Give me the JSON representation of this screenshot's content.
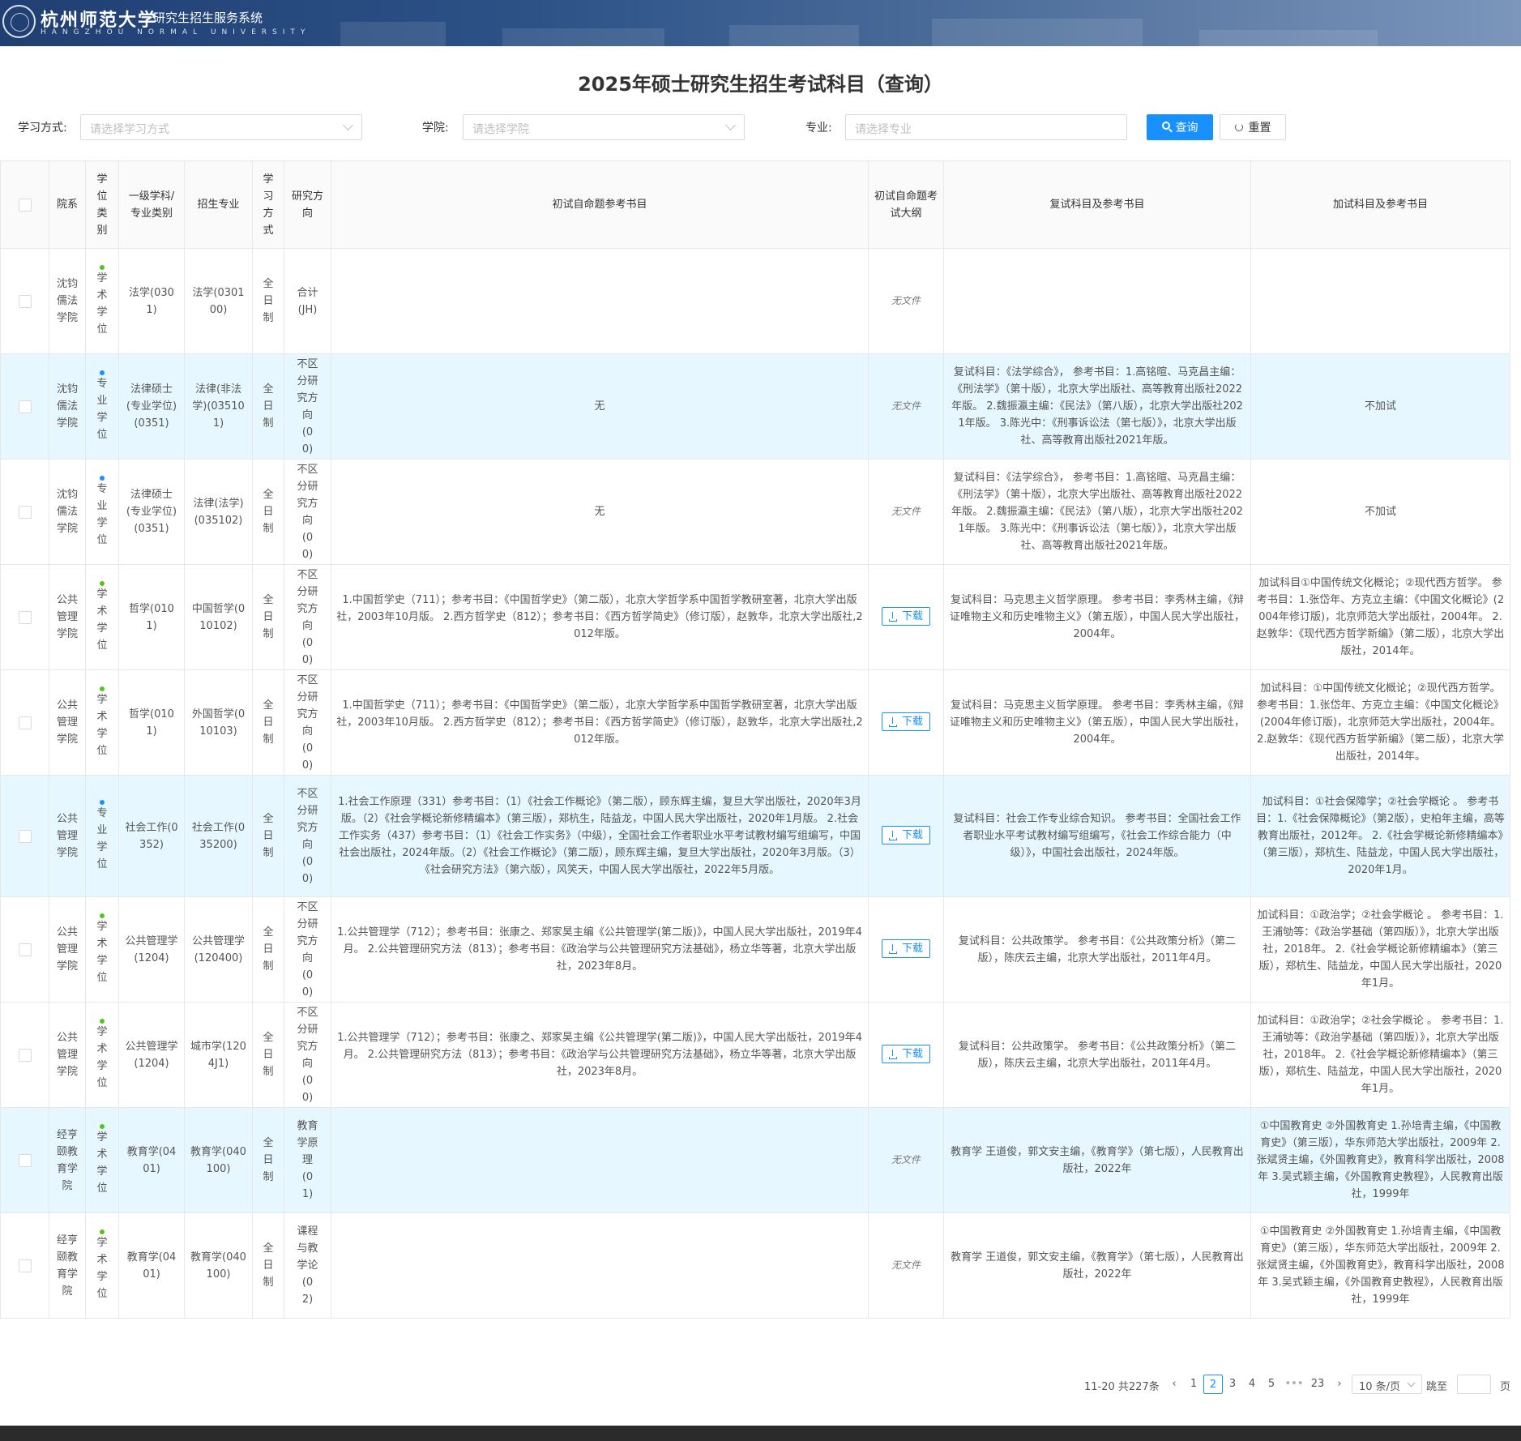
{
  "header": {
    "logo_text": "杭州师范大学",
    "logo_en": "HANGZHOU NORMAL UNIVERSITY",
    "system_title": "研究生招生服务系统"
  },
  "page_title": "2025年硕士研究生招生考试科目（查询）",
  "filters": {
    "mode_label": "学习方式:",
    "mode_placeholder": "请选择学习方式",
    "college_label": "学院:",
    "college_placeholder": "请选择学院",
    "major_label": "专业:",
    "major_placeholder": "请选择专业",
    "search_label": "查询",
    "reset_label": "重置"
  },
  "table": {
    "columns": [
      "院系",
      "学位类别",
      "一级学科/专业类别",
      "招生专业",
      "学习方式",
      "研究方向",
      "初试自命题参考书目",
      "初试自命题考试大纲",
      "复试科目及参考书目",
      "加试科目及参考书目"
    ],
    "rows": [
      {
        "college": "沈钧儒法学院",
        "degree_type": "学术学位",
        "dot": "green",
        "discipline": "法学(0301)",
        "major": "法学(030100)",
        "mode": "全日制",
        "direction": "合计(JH)",
        "initial_books": "",
        "outline": "无文件",
        "retest": "",
        "extra": ""
      },
      {
        "college": "沈钧儒法学院",
        "degree_type": "专业学位",
        "dot": "blue",
        "discipline": "法律硕士(专业学位)(0351)",
        "major": "法律(非法学)(035101)",
        "mode": "全日制",
        "direction": "不区分研究方向(00)",
        "initial_books": "无",
        "outline": "无文件",
        "retest": "复试科目：《法学综合》， 参考书目：1.高铭暄、马克昌主编：《刑法学》（第十版），北京大学出版社、高等教育出版社2022年版。 2.魏振瀛主编：《民法》（第八版），北京大学出版社2021年版。 3.陈光中：《刑事诉讼法（第七版）》，北京大学出版社、高等教育出版社2021年版。",
        "extra": "不加试"
      },
      {
        "college": "沈钧儒法学院",
        "degree_type": "专业学位",
        "dot": "blue",
        "discipline": "法律硕士(专业学位)(0351)",
        "major": "法律(法学)(035102)",
        "mode": "全日制",
        "direction": "不区分研究方向(00)",
        "initial_books": "无",
        "outline": "无文件",
        "retest": "复试科目：《法学综合》， 参考书目：1.高铭暄、马克昌主编：《刑法学》（第十版），北京大学出版社、高等教育出版社2022年版。 2.魏振瀛主编：《民法》（第八版），北京大学出版社2021年版。 3.陈光中：《刑事诉讼法（第七版）》，北京大学出版社、高等教育出版社2021年版。",
        "extra": "不加试"
      },
      {
        "college": "公共管理学院",
        "degree_type": "学术学位",
        "dot": "green",
        "discipline": "哲学(0101)",
        "major": "中国哲学(010102)",
        "mode": "全日制",
        "direction": "不区分研究方向(00)",
        "initial_books": "1.中国哲学史（711）；参考书目：《中国哲学史》（第二版），北京大学哲学系中国哲学教研室著，北京大学出版社，2003年10月版。 2.西方哲学史（812）；参考书目：《西方哲学简史》（修订版），赵敦华，北京大学出版社,2012年版。",
        "outline": "下载",
        "retest": "复试科目：马克思主义哲学原理。 参考书目：李秀林主编，《辩证唯物主义和历史唯物主义》（第五版），中国人民大学出版社，2004年。",
        "extra": "加试科目①中国传统文化概论；②现代西方哲学。 参考书目：1.张岱年、方克立主编：《中国文化概论》(2004年修订版)，北京师范大学出版社，2004年。 2.赵敦华：《现代西方哲学新编》（第二版），北京大学出版社，2014年。"
      },
      {
        "college": "公共管理学院",
        "degree_type": "学术学位",
        "dot": "green",
        "discipline": "哲学(0101)",
        "major": "外国哲学(010103)",
        "mode": "全日制",
        "direction": "不区分研究方向(00)",
        "initial_books": "1.中国哲学史（711）；参考书目：《中国哲学史》（第二版），北京大学哲学系中国哲学教研室著，北京大学出版社，2003年10月版。 2.西方哲学史（812）；参考书目：《西方哲学简史》（修订版），赵敦华，北京大学出版社,2012年版。",
        "outline": "下载",
        "retest": "复试科目：马克思主义哲学原理。 参考书目：李秀林主编，《辩证唯物主义和历史唯物主义》（第五版），中国人民大学出版社，2004年。",
        "extra": "加试科目：①中国传统文化概论；②现代西方哲学。 参考书目：1.张岱年、方克立主编：《中国文化概论》(2004年修订版)，北京师范大学出版社，2004年。 2.赵敦华：《现代西方哲学新编》（第二版），北京大学出版社，2014年。"
      },
      {
        "college": "公共管理学院",
        "degree_type": "专业学位",
        "dot": "blue",
        "discipline": "社会工作(0352)",
        "major": "社会工作(035200)",
        "mode": "全日制",
        "direction": "不区分研究方向(00)",
        "initial_books": "1.社会工作原理（331）参考书目：（1）《社会工作概论》（第二版），顾东辉主编，复旦大学出版社，2020年3月版。（2）《社会学概论新修精编本》（第三版），郑杭生，陆益龙，中国人民大学出版社，2020年1月版。 2.社会工作实务（437）参考书目：（1）《社会工作实务》（中级），全国社会工作者职业水平考试教材编写组编写，中国社会出版社，2024年版。（2）《社会工作概论》（第二版），顾东辉主编，复旦大学出版社，2020年3月版。（3）《社会研究方法》（第六版），风笑天，中国人民大学出版社，2022年5月版。",
        "outline": "下载",
        "retest": "复试科目：社会工作专业综合知识。 参考书目：全国社会工作者职业水平考试教材编写组编写，《社会工作综合能力（中级）》，中国社会出版社，2024年版。",
        "extra": "加试科目：①社会保障学；②社会学概论 。 参考书目：1.《社会保障概论》（第2版），史柏年主编，高等教育出版社，2012年。 2.《社会学概论新修精编本》（第三版），郑杭生、陆益龙，中国人民大学出版社，2020年1月。"
      },
      {
        "college": "公共管理学院",
        "degree_type": "学术学位",
        "dot": "green",
        "discipline": "公共管理学(1204)",
        "major": "公共管理学(120400)",
        "mode": "全日制",
        "direction": "不区分研究方向(00)",
        "initial_books": "1.公共管理学（712）；参考书目：张康之、郑家昊主编《公共管理学(第二版)》，中国人民大学出版社，2019年4月。 2.公共管理研究方法（813）；参考书目：《政治学与公共管理研究方法基础》，杨立华等著，北京大学出版社，2023年8月。",
        "outline": "下载",
        "retest": "复试科目：公共政策学。 参考书目：《公共政策分析》（第二版），陈庆云主编，北京大学出版社，2011年4月。",
        "extra": "加试科目：①政治学；②社会学概论 。 参考书目：1.王浦劬等：《政治学基础（第四版）》，北京大学出版社，2018年。 2.《社会学概论新修精编本》（第三版），郑杭生、陆益龙，中国人民大学出版社，2020年1月。"
      },
      {
        "college": "公共管理学院",
        "degree_type": "学术学位",
        "dot": "green",
        "discipline": "公共管理学(1204)",
        "major": "城市学(1204J1)",
        "mode": "全日制",
        "direction": "不区分研究方向(00)",
        "initial_books": "1.公共管理学（712）；参考书目：张康之、郑家昊主编《公共管理学(第二版)》，中国人民大学出版社，2019年4月。 2.公共管理研究方法（813）；参考书目：《政治学与公共管理研究方法基础》，杨立华等著，北京大学出版社，2023年8月。",
        "outline": "下载",
        "retest": "复试科目：公共政策学。 参考书目：《公共政策分析》（第二版），陈庆云主编，北京大学出版社，2011年4月。",
        "extra": "加试科目：①政治学；②社会学概论 。 参考书目：1.王浦劬等：《政治学基础（第四版）》，北京大学出版社，2018年。 2.《社会学概论新修精编本》（第三版），郑杭生、陆益龙，中国人民大学出版社，2020年1月。"
      },
      {
        "college": "经亨颐教育学院",
        "degree_type": "学术学位",
        "dot": "green",
        "discipline": "教育学(0401)",
        "major": "教育学(040100)",
        "mode": "全日制",
        "direction": "教育学原理(01)",
        "initial_books": "",
        "outline": "无文件",
        "retest": "教育学 王道俊，郭文安主编，《教育学》（第七版），人民教育出版社，2022年",
        "extra": "①中国教育史 ②外国教育史 1.孙培青主编，《中国教育史》（第三版），华东师范大学出版社，2009年 2.张斌贤主编，《外国教育史》，教育科学出版社，2008年 3.吴式颖主编，《外国教育史教程》，人民教育出版社，1999年"
      },
      {
        "college": "经亨颐教育学院",
        "degree_type": "学术学位",
        "dot": "green",
        "discipline": "教育学(0401)",
        "major": "教育学(040100)",
        "mode": "全日制",
        "direction": "课程与教学论(02)",
        "initial_books": "",
        "outline": "无文件",
        "retest": "教育学 王道俊，郭文安主编，《教育学》（第七版），人民教育出版社，2022年",
        "extra": "①中国教育史 ②外国教育史 1.孙培青主编，《中国教育史》（第三版），华东师范大学出版社，2009年 2.张斌贤主编，《外国教育史》，教育科学出版社，2008年 3.吴式颖主编，《外国教育史教程》，人民教育出版社，1999年"
      }
    ]
  },
  "pagination": {
    "total_text": "11-20 共227条",
    "prev": "‹",
    "next": "›",
    "pages": [
      "1",
      "2",
      "3",
      "4",
      "5",
      "•••",
      "23"
    ],
    "current": "2",
    "page_size": "10 条/页",
    "jump_label": "跳至",
    "page_unit": "页"
  },
  "colors": {
    "primary": "#1890ff",
    "highlight_row": "#e6f7ff",
    "academic_dot": "#52c41a",
    "professional_dot": "#1890ff"
  }
}
